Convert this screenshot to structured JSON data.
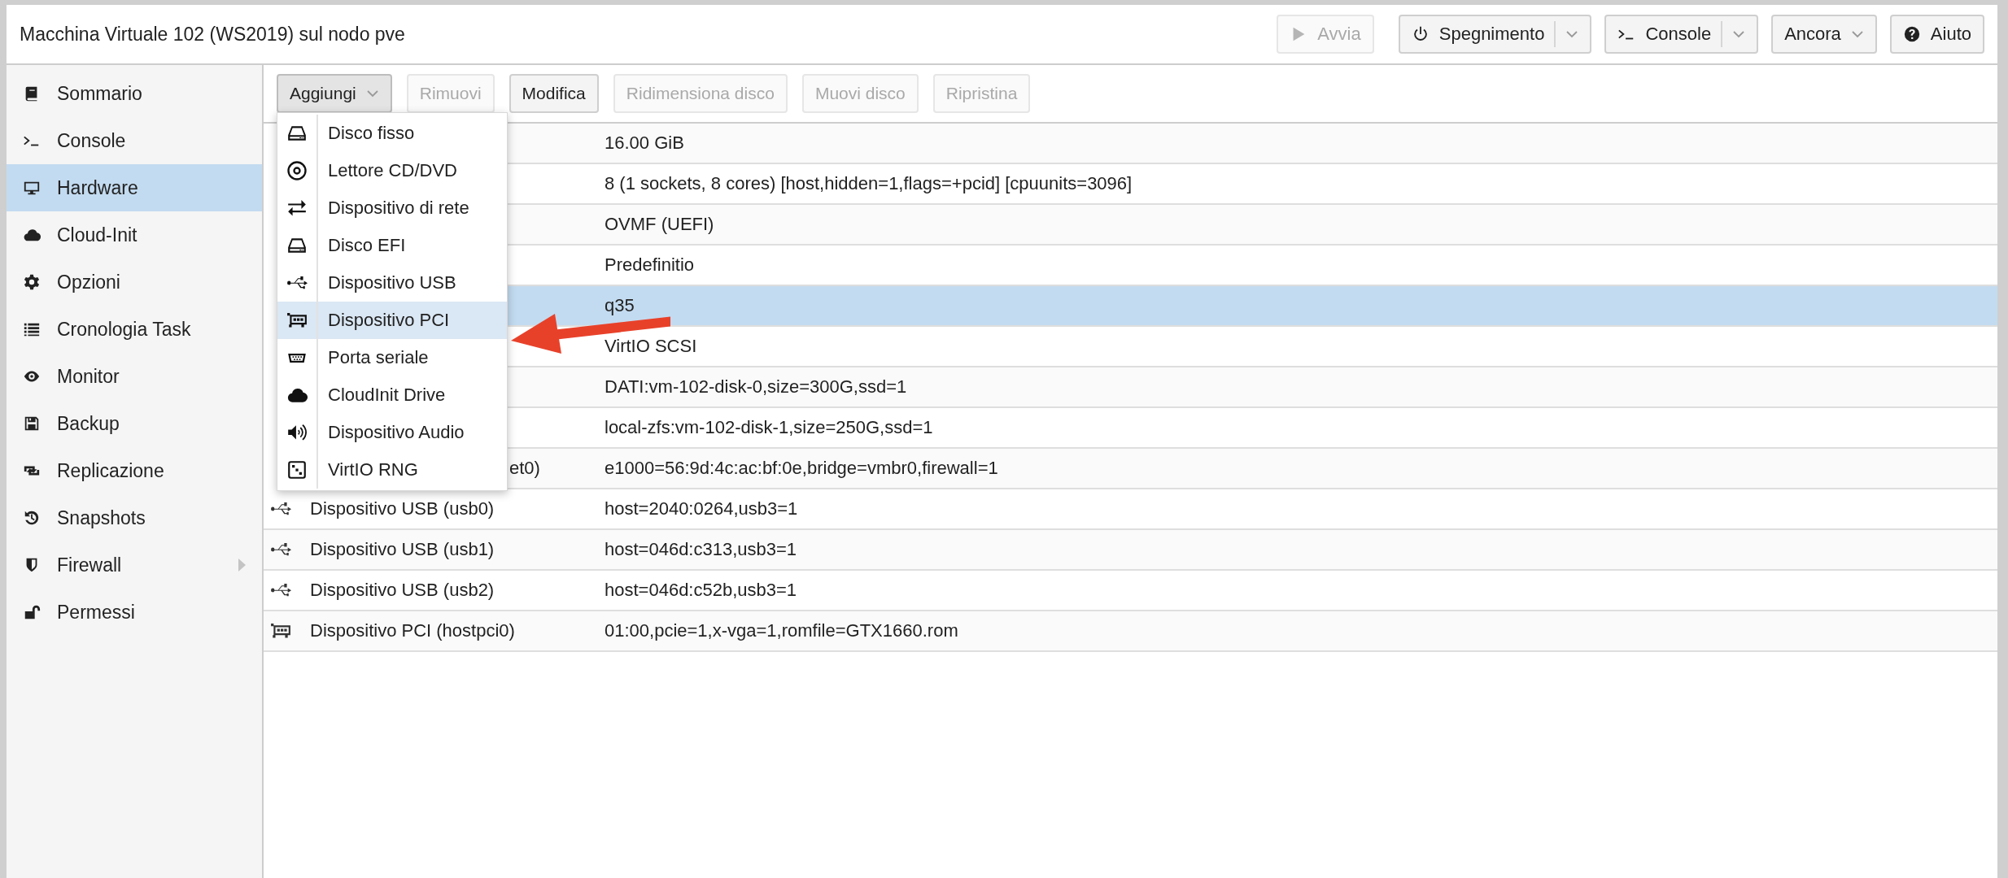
{
  "window": {
    "title": "Macchina Virtuale 102 (WS2019) sul nodo pve"
  },
  "header_buttons": [
    {
      "label": "Avvia",
      "kind": "play",
      "disabled": true
    },
    {
      "label": "Spegnimento",
      "kind": "power",
      "disabled": false,
      "split": true
    },
    {
      "label": "Console",
      "kind": "terminal",
      "disabled": false,
      "split": true
    },
    {
      "label": "Ancora",
      "disabled": false,
      "dropdown": true
    },
    {
      "label": "Aiuto",
      "kind": "help",
      "disabled": false
    }
  ],
  "sidebar": {
    "items": [
      {
        "label": "Sommario",
        "kind": "book",
        "selected": false
      },
      {
        "label": "Console",
        "kind": "terminal",
        "selected": false
      },
      {
        "label": "Hardware",
        "kind": "monitor",
        "selected": true
      },
      {
        "label": "Cloud-Init",
        "kind": "cloud",
        "selected": false
      },
      {
        "label": "Opzioni",
        "kind": "gear",
        "selected": false
      },
      {
        "label": "Cronologia Task",
        "kind": "list",
        "selected": false
      },
      {
        "label": "Monitor",
        "kind": "eye",
        "selected": false
      },
      {
        "label": "Backup",
        "kind": "floppy",
        "selected": false
      },
      {
        "label": "Replicazione",
        "kind": "retweet",
        "selected": false
      },
      {
        "label": "Snapshots",
        "kind": "history",
        "selected": false
      },
      {
        "label": "Firewall",
        "kind": "shield",
        "selected": false,
        "expanded": false
      },
      {
        "label": "Permessi",
        "kind": "unlock",
        "selected": false
      }
    ]
  },
  "toolbar": [
    {
      "label": "Aggiungi",
      "disabled": false,
      "pressed": true,
      "dropdown": true
    },
    {
      "label": "Rimuovi",
      "disabled": true,
      "pressed": false
    },
    {
      "label": "Modifica",
      "disabled": false,
      "pressed": false
    },
    {
      "label": "Ridimensiona disco",
      "disabled": true,
      "pressed": false
    },
    {
      "label": "Muovi disco",
      "disabled": true,
      "pressed": false
    },
    {
      "label": "Ripristina",
      "disabled": true,
      "pressed": false
    }
  ],
  "table": {
    "rows": [
      {
        "value": "16.00 GiB",
        "selected": false
      },
      {
        "value": "8 (1 sockets, 8 cores) [host,hidden=1,flags=+pcid] [cpuunits=3096]",
        "selected": false
      },
      {
        "value": "OVMF (UEFI)",
        "selected": false
      },
      {
        "value": "Predefinitio",
        "selected": false
      },
      {
        "value": "q35",
        "selected": true
      },
      {
        "value": "VirtIO SCSI",
        "selected": false
      },
      {
        "value": "DATI:vm-102-disk-0,size=300G,ssd=1",
        "selected": false
      },
      {
        "value": "local-zfs:vm-102-disk-1,size=250G,ssd=1",
        "selected": false
      },
      {
        "name": "et0)",
        "name_cut": true,
        "value": "e1000=56:9d:4c:ac:bf:0e,bridge=vmbr0,firewall=1",
        "selected": false
      },
      {
        "kind": "usb",
        "name": "Dispositivo USB (usb0)",
        "value": "host=2040:0264,usb3=1",
        "selected": false
      },
      {
        "kind": "usb",
        "name": "Dispositivo USB (usb1)",
        "value": "host=046d:c313,usb3=1",
        "selected": false
      },
      {
        "kind": "usb",
        "name": "Dispositivo USB (usb2)",
        "value": "host=046d:c52b,usb3=1",
        "selected": false
      },
      {
        "kind": "pci",
        "name": "Dispositivo PCI (hostpci0)",
        "value": "01:00,pcie=1,x-vga=1,romfile=GTX1660.rom",
        "selected": false
      }
    ]
  },
  "add_menu": {
    "items": [
      {
        "label": "Disco fisso",
        "kind": "hdd",
        "selected": false
      },
      {
        "label": "Lettore CD/DVD",
        "kind": "cd",
        "selected": false
      },
      {
        "label": "Dispositivo di rete",
        "kind": "exchange",
        "selected": false
      },
      {
        "label": "Disco EFI",
        "kind": "hdd",
        "selected": false
      },
      {
        "label": "Dispositivo USB",
        "kind": "usb",
        "selected": false
      },
      {
        "label": "Dispositivo PCI",
        "kind": "pci",
        "selected": true
      },
      {
        "label": "Porta seriale",
        "kind": "serial",
        "selected": false
      },
      {
        "label": "CloudInit Drive",
        "kind": "cloud",
        "selected": false
      },
      {
        "label": "Dispositivo Audio",
        "kind": "speaker",
        "selected": false
      },
      {
        "label": "VirtIO RNG",
        "kind": "dice",
        "selected": false
      }
    ]
  }
}
